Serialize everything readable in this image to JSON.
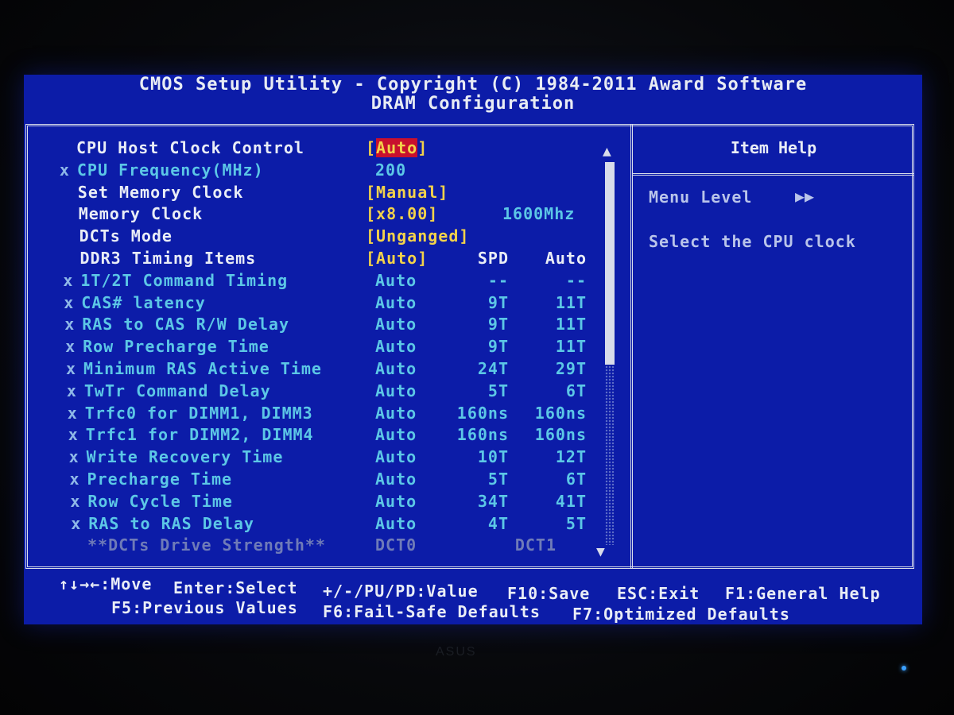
{
  "header": {
    "title": "CMOS Setup Utility - Copyright (C) 1984-2011 Award Software",
    "subtitle": "DRAM Configuration"
  },
  "rows": [
    {
      "marker": "",
      "label": "CPU Host Clock Control",
      "value": "[Auto]",
      "spd": "",
      "auto": "",
      "state": "active"
    },
    {
      "marker": "x",
      "label": "CPU Frequency(MHz)",
      "value": "200",
      "spd": "",
      "auto": "",
      "state": "disabled"
    },
    {
      "marker": "",
      "label": "Set Memory Clock",
      "value": "[Manual]",
      "spd": "",
      "auto": "",
      "state": "active"
    },
    {
      "marker": "",
      "label": "Memory Clock",
      "value": "[x8.00]",
      "spd": "",
      "auto": "",
      "state": "active",
      "extra": "1600Mhz"
    },
    {
      "marker": "",
      "label": "DCTs Mode",
      "value": "[Unganged]",
      "spd": "",
      "auto": "",
      "state": "active"
    },
    {
      "marker": "",
      "label": "DDR3 Timing Items",
      "value": "[Auto]",
      "spd": "SPD",
      "auto": "Auto",
      "state": "active"
    },
    {
      "marker": "x",
      "label": "1T/2T Command Timing",
      "value": "Auto",
      "spd": "--",
      "auto": "--",
      "state": "disabled"
    },
    {
      "marker": "x",
      "label": "CAS# latency",
      "value": "Auto",
      "spd": "9T",
      "auto": "11T",
      "state": "disabled"
    },
    {
      "marker": "x",
      "label": "RAS to CAS R/W Delay",
      "value": "Auto",
      "spd": "9T",
      "auto": "11T",
      "state": "disabled"
    },
    {
      "marker": "x",
      "label": "Row Precharge Time",
      "value": "Auto",
      "spd": "9T",
      "auto": "11T",
      "state": "disabled"
    },
    {
      "marker": "x",
      "label": "Minimum RAS Active Time",
      "value": "Auto",
      "spd": "24T",
      "auto": "29T",
      "state": "disabled"
    },
    {
      "marker": "x",
      "label": "TwTr Command Delay",
      "value": "Auto",
      "spd": "5T",
      "auto": "6T",
      "state": "disabled"
    },
    {
      "marker": "x",
      "label": "Trfc0 for DIMM1, DIMM3",
      "value": "Auto",
      "spd": "160ns",
      "auto": "160ns",
      "state": "disabled"
    },
    {
      "marker": "x",
      "label": "Trfc1 for DIMM2, DIMM4",
      "value": "Auto",
      "spd": "160ns",
      "auto": "160ns",
      "state": "disabled"
    },
    {
      "marker": "x",
      "label": "Write Recovery Time",
      "value": "Auto",
      "spd": "10T",
      "auto": "12T",
      "state": "disabled"
    },
    {
      "marker": "x",
      "label": "Precharge Time",
      "value": "Auto",
      "spd": "5T",
      "auto": "6T",
      "state": "disabled"
    },
    {
      "marker": "x",
      "label": "Row Cycle Time",
      "value": "Auto",
      "spd": "34T",
      "auto": "41T",
      "state": "disabled"
    },
    {
      "marker": "x",
      "label": "RAS to RAS Delay",
      "value": "Auto",
      "spd": "4T",
      "auto": "5T",
      "state": "disabled"
    },
    {
      "marker": "",
      "label": "**DCTs Drive Strength**",
      "value": "DCT0",
      "spd": "",
      "auto": "DCT1",
      "state": "dim"
    }
  ],
  "help": {
    "title": "Item Help",
    "menu_level": "Menu Level",
    "arrows": "▶▶",
    "text": "Select the CPU clock"
  },
  "footer": {
    "move": "↑↓→←:Move",
    "select": "Enter:Select",
    "value": "+/-/PU/PD:Value",
    "save": "F10:Save",
    "exit": "ESC:Exit",
    "general_help": "F1:General Help",
    "previous": "F5:Previous Values",
    "failsafe": "F6:Fail-Safe Defaults",
    "optimized": "F7:Optimized Defaults"
  },
  "scroll": {
    "up": "▲",
    "down": "▼"
  },
  "bezel": {
    "logo": "ASUS"
  },
  "colors": {
    "screen_bg": "#0c1ca8",
    "label_active": "#e9edf6",
    "value_active": "#f3d24a",
    "disabled": "#5cc7e6",
    "highlight": "#c8102e"
  }
}
